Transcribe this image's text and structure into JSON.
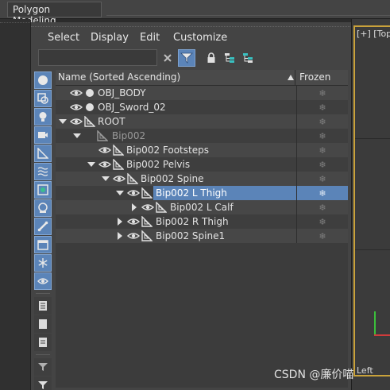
{
  "ribbon": {
    "tab_label": "Polygon Modeling"
  },
  "menu": {
    "items": [
      "Select",
      "Display",
      "Edit",
      "Customize"
    ]
  },
  "search": {
    "value": ""
  },
  "columns": {
    "name": "Name (Sorted Ascending)",
    "frozen": "Frozen"
  },
  "frozen_glyph": "❄",
  "tree_rows": [
    {
      "label": "OBJ_BODY"
    },
    {
      "label": "OBJ_Sword_02"
    },
    {
      "label": "ROOT"
    },
    {
      "label": "Bip002"
    },
    {
      "label": "Bip002 Footsteps"
    },
    {
      "label": "Bip002 Pelvis"
    },
    {
      "label": "Bip002 Spine"
    },
    {
      "label": "Bip002 L Thigh"
    },
    {
      "label": "Bip002 L Calf"
    },
    {
      "label": "Bip002 R Thigh"
    },
    {
      "label": "Bip002 Spine1"
    }
  ],
  "viewport": {
    "label_top": "[+] [Top",
    "label_bottom": "Left"
  },
  "watermark": "CSDN @廉价喵",
  "colors": {
    "selection": "#5b84b8",
    "viewport_border": "#c9a23b",
    "panel": "#444444"
  },
  "icons": {
    "clear": "close-icon",
    "filter": "filter-icon",
    "lock": "lock-icon",
    "hierarchy": "hierarchy-icon",
    "hierarchy2": "hierarchy-expand-icon",
    "eye": "eye-icon",
    "bone": "bone-icon",
    "sphere": "sphere-icon"
  }
}
